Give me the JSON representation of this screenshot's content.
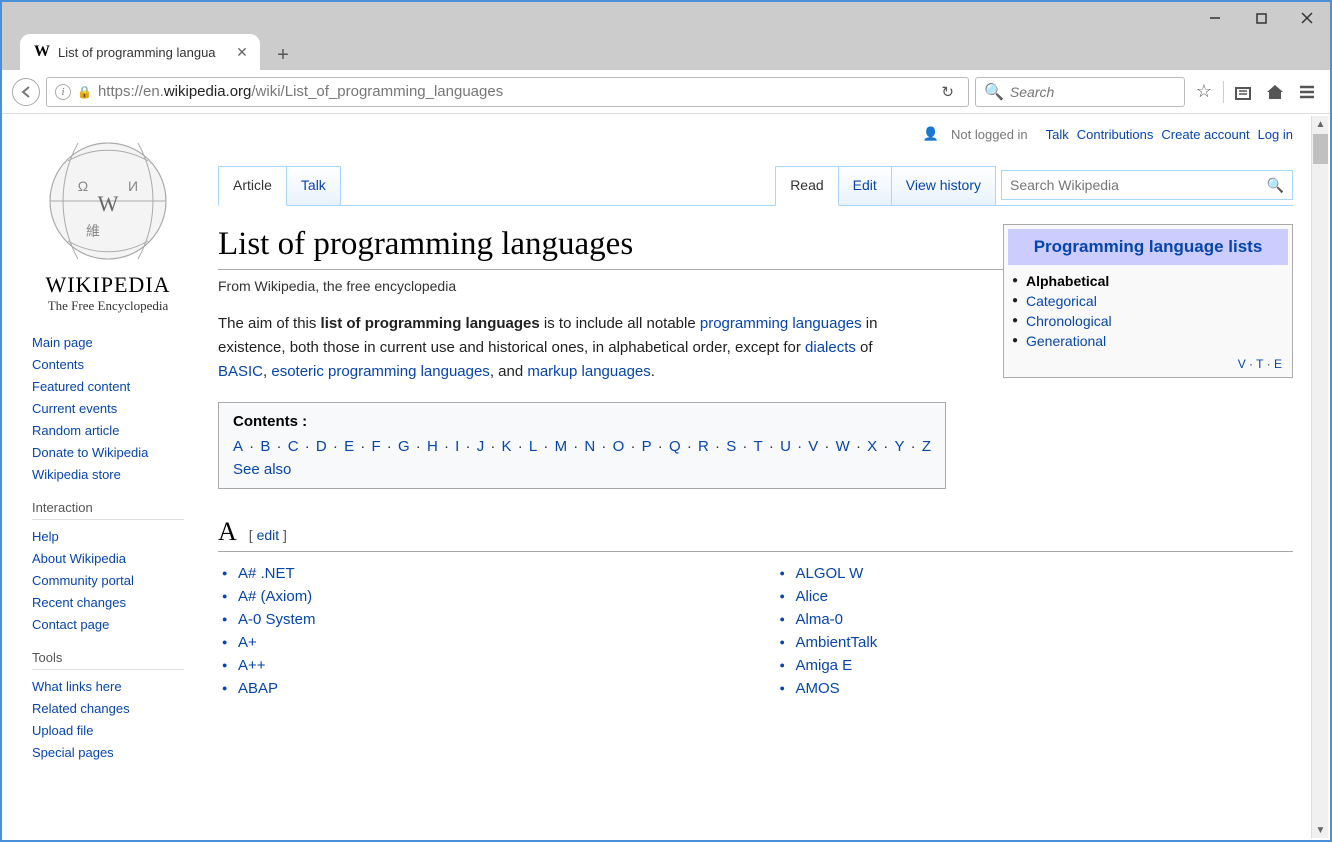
{
  "browser": {
    "tab_title": "List of programming langua",
    "url_proto": "https://",
    "url_sub": "en.",
    "url_domain": "wikipedia.org",
    "url_path": "/wiki/List_of_programming_languages",
    "search_placeholder": "Search"
  },
  "topbar": {
    "not_logged": "Not logged in",
    "links": [
      "Talk",
      "Contributions",
      "Create account",
      "Log in"
    ]
  },
  "logo": {
    "name": "WIKIPEDIA",
    "sub": "The Free Encyclopedia"
  },
  "nav": {
    "main": [
      "Main page",
      "Contents",
      "Featured content",
      "Current events",
      "Random article",
      "Donate to Wikipedia",
      "Wikipedia store"
    ],
    "interaction_h": "Interaction",
    "interaction": [
      "Help",
      "About Wikipedia",
      "Community portal",
      "Recent changes",
      "Contact page"
    ],
    "tools_h": "Tools",
    "tools": [
      "What links here",
      "Related changes",
      "Upload file",
      "Special pages"
    ]
  },
  "tabs": {
    "article": "Article",
    "talk": "Talk",
    "read": "Read",
    "edit": "Edit",
    "history": "View history",
    "search_ph": "Search Wikipedia"
  },
  "article": {
    "title": "List of programming languages",
    "from": "From Wikipedia, the free encyclopedia",
    "intro_1": "The aim of this ",
    "intro_bold": "list of programming languages",
    "intro_2": " is to include all notable ",
    "link_pl": "programming languages",
    "intro_3": " in existence, both those in current use and historical ones, in alphabetical order, except for ",
    "link_dial": "dialects",
    "intro_4": " of ",
    "link_basic": "BASIC",
    "intro_5": ", ",
    "link_eso": "esoteric programming languages",
    "intro_6": ", and ",
    "link_markup": "markup languages",
    "intro_7": "."
  },
  "infobox": {
    "title": "Programming language lists",
    "items": [
      "Alphabetical",
      "Categorical",
      "Chronological",
      "Generational"
    ],
    "vte": [
      "V",
      "T",
      "E"
    ]
  },
  "toc": {
    "title": "Contents :",
    "letters": [
      "A",
      "B",
      "C",
      "D",
      "E",
      "F",
      "G",
      "H",
      "I",
      "J",
      "K",
      "L",
      "M",
      "N",
      "O",
      "P",
      "Q",
      "R",
      "S",
      "T",
      "U",
      "V",
      "W",
      "X",
      "Y",
      "Z"
    ],
    "seealso": "See also"
  },
  "section_a": {
    "letter": "A",
    "edit": "edit",
    "col1": [
      "A# .NET",
      "A# (Axiom)",
      "A-0 System",
      "A+",
      "A++",
      "ABAP"
    ],
    "col2": [
      "ALGOL W",
      "Alice",
      "Alma-0",
      "AmbientTalk",
      "Amiga E",
      "AMOS"
    ]
  }
}
